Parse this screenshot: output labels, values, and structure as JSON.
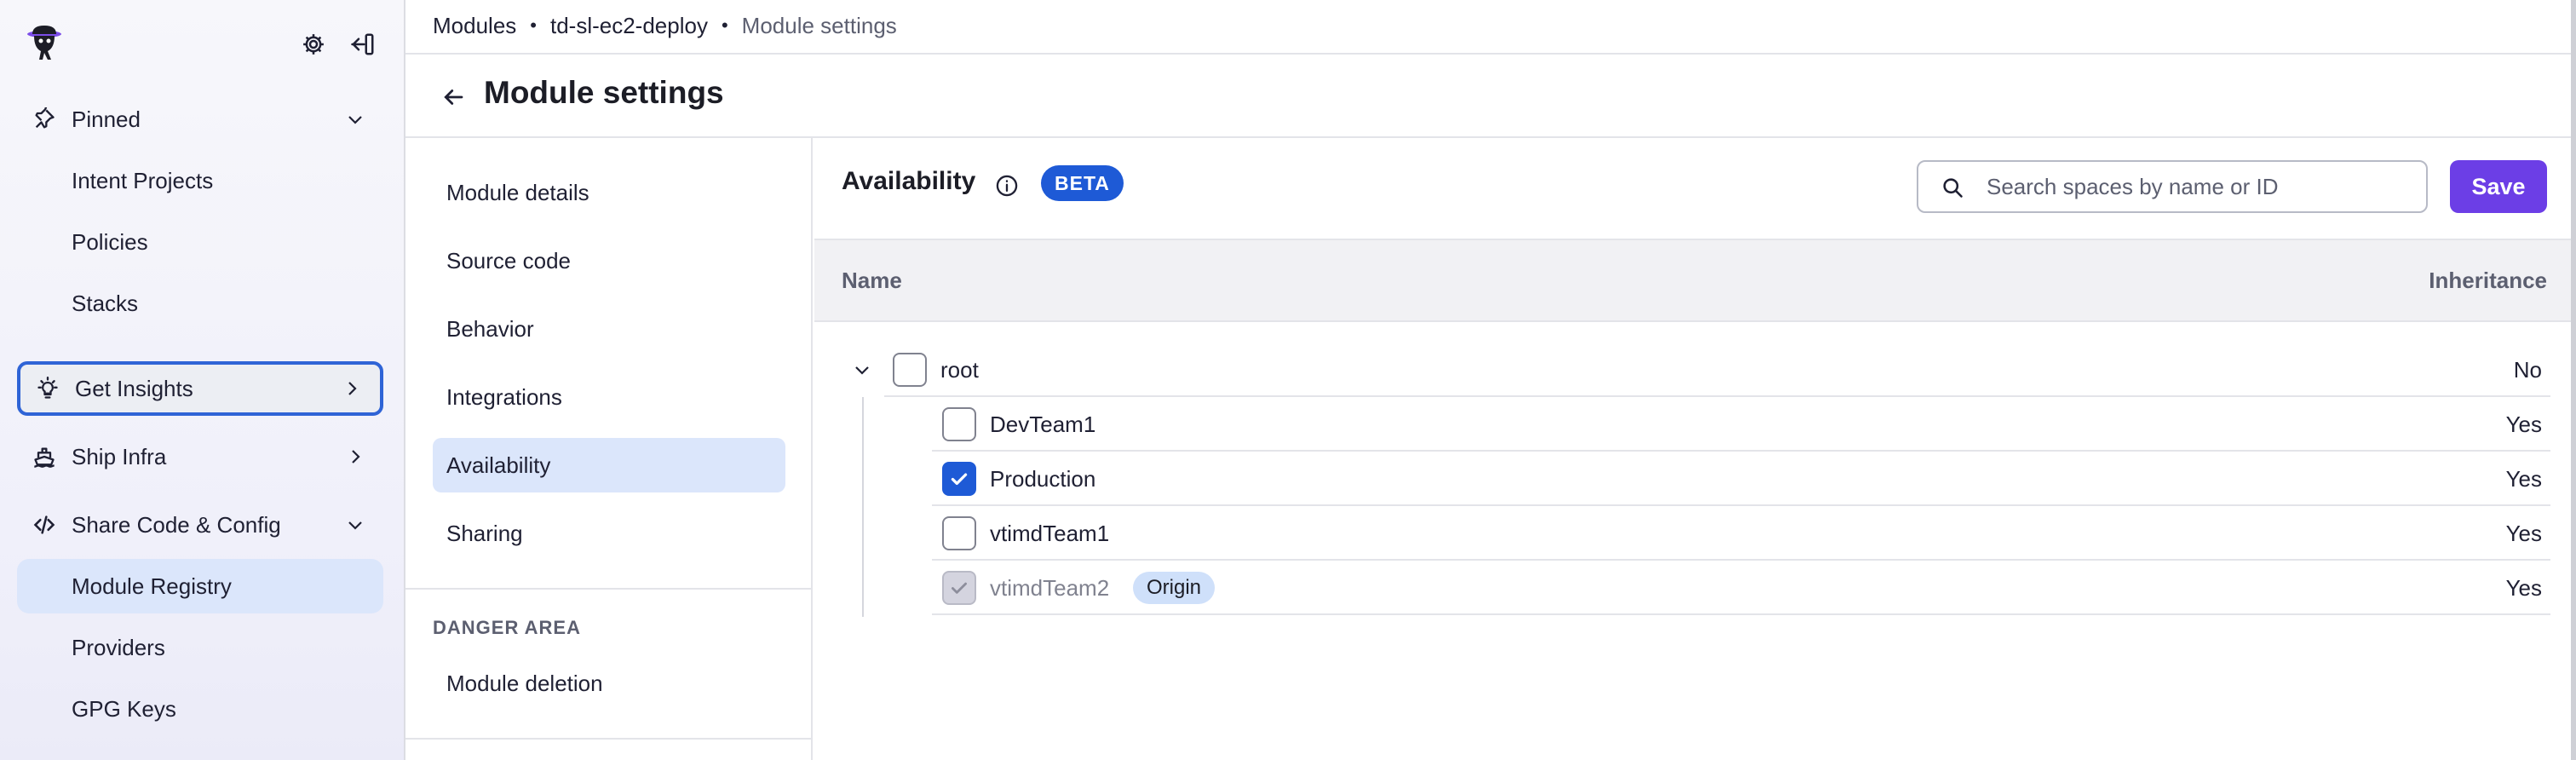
{
  "sidebar": {
    "pinned": {
      "label": "Pinned",
      "items": [
        "Intent Projects",
        "Policies",
        "Stacks"
      ]
    },
    "get_insights": "Get Insights",
    "ship_infra": "Ship Infra",
    "share_code": {
      "label": "Share Code & Config",
      "items": [
        "Module Registry",
        "Providers",
        "GPG Keys"
      ]
    },
    "active_item": "Module Registry"
  },
  "breadcrumb": [
    "Modules",
    "td-sl-ec2-deploy",
    "Module settings"
  ],
  "breadcrumb_separator": "•",
  "page_title": "Module settings",
  "settings_menu": {
    "items": [
      "Module details",
      "Source code",
      "Behavior",
      "Integrations",
      "Availability",
      "Sharing"
    ],
    "active": "Availability",
    "danger_title": "DANGER AREA",
    "danger_items": [
      "Module deletion"
    ]
  },
  "availability": {
    "title": "Availability",
    "badge": "BETA",
    "search_placeholder": "Search spaces by name or ID",
    "save_label": "Save",
    "columns": {
      "name": "Name",
      "inheritance": "Inheritance"
    },
    "rows": [
      {
        "name": "root",
        "inheritance": "No",
        "checked": false,
        "expanded": true
      },
      {
        "name": "DevTeam1",
        "inheritance": "Yes",
        "checked": false
      },
      {
        "name": "Production",
        "inheritance": "Yes",
        "checked": true
      },
      {
        "name": "vtimdTeam1",
        "inheritance": "Yes",
        "checked": false
      },
      {
        "name": "vtimdTeam2",
        "inheritance": "Yes",
        "checked": true,
        "disabled": true,
        "badge": "Origin"
      }
    ]
  },
  "colors": {
    "accent_blue": "#1e5ad6",
    "save_purple": "#6c3ee6",
    "active_bg": "#dbe6fb",
    "origin_badge_bg": "#cfe0fa"
  }
}
